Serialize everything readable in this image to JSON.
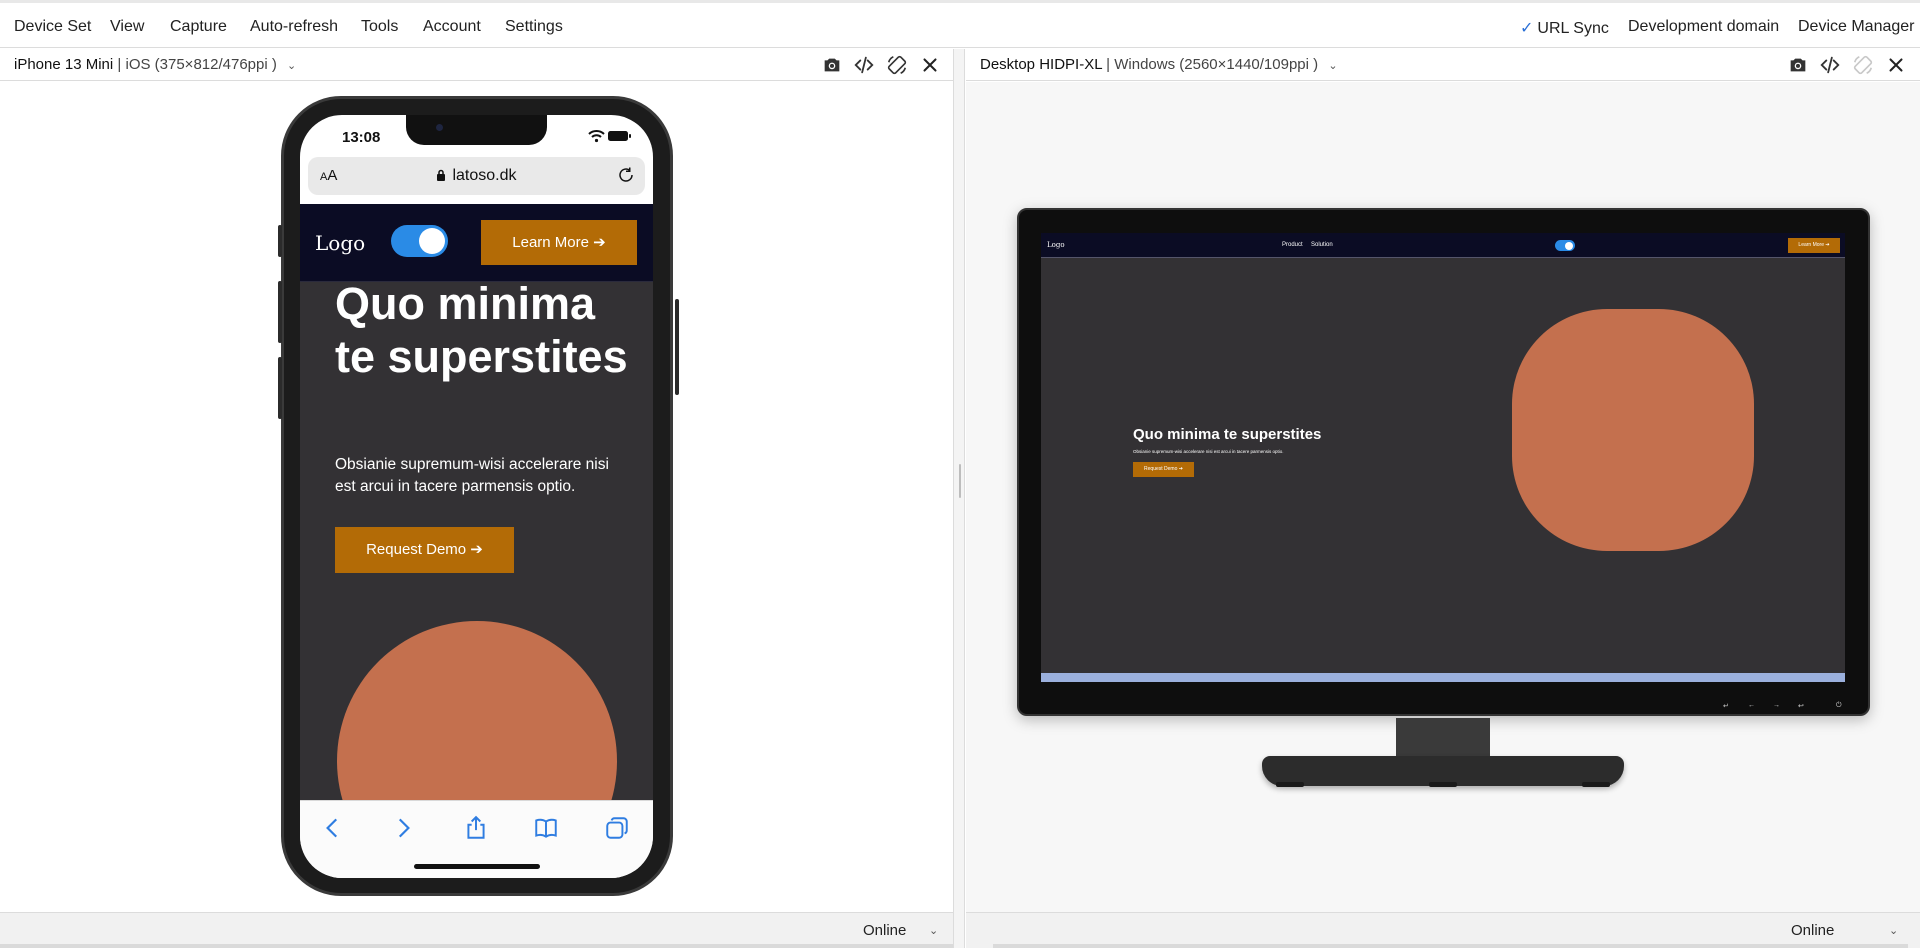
{
  "menu": {
    "left_items": [
      "Device Set",
      "View",
      "Capture",
      "Auto-refresh",
      "Tools",
      "Account",
      "Settings"
    ],
    "url_sync": "URL Sync",
    "development_domain": "Development domain",
    "device_manager": "Device Manager"
  },
  "left_pane": {
    "device_name": "iPhone 13 Mini",
    "device_spec": "iOS (375×812/476ppi )",
    "status": "Online"
  },
  "right_pane": {
    "device_name": "Desktop HIDPI-XL",
    "device_spec": "Windows (2560×1440/109ppi )",
    "status": "Online"
  },
  "phone": {
    "time": "13:08",
    "text_size_button": "AA",
    "url": "latoso.dk"
  },
  "site": {
    "logo": "Logo",
    "learn_more": "Learn More ➔",
    "headline": "Quo minima te superstites",
    "paragraph": "Obsianie supremum-wisi accelerare nisi est arcui in tacere parmensis optio.",
    "request_demo": "Request Demo ➔",
    "nav_links": [
      "Product",
      "Solution"
    ],
    "colors": {
      "nav": "#0b0c24",
      "body": "#333134",
      "button": "#b36b06",
      "shape": "#c4704e",
      "toggle": "#2a8be6"
    }
  }
}
